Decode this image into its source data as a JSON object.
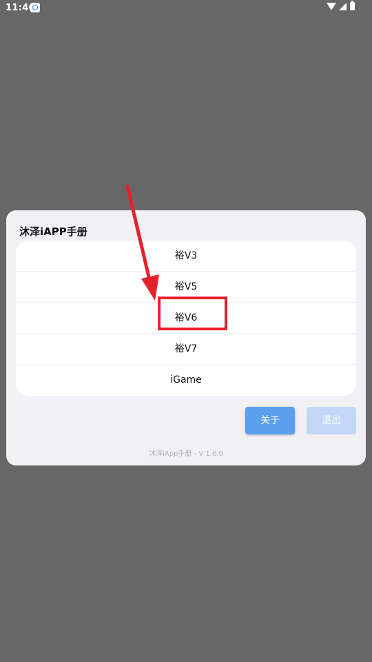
{
  "status_bar": {
    "time": "11:46",
    "icons": [
      "notification-icon",
      "wifi-icon",
      "signal-icon",
      "battery-icon"
    ]
  },
  "dialog": {
    "title": "沐泽iAPP手册",
    "options": [
      "裕V3",
      "裕V5",
      "裕V6",
      "裕V7",
      "iGame"
    ],
    "about_label": "关于",
    "exit_label": "退出",
    "footer": "沐泽iApp手册 - V 1.6.0"
  },
  "annotation": {
    "color": "#e8202a",
    "highlighted_option": "裕V6"
  },
  "colors": {
    "backdrop": "#676767",
    "dialog_bg": "#f1f0f5",
    "primary_button": "#5aa0ee",
    "disabled_button": "#c1d7f5"
  }
}
